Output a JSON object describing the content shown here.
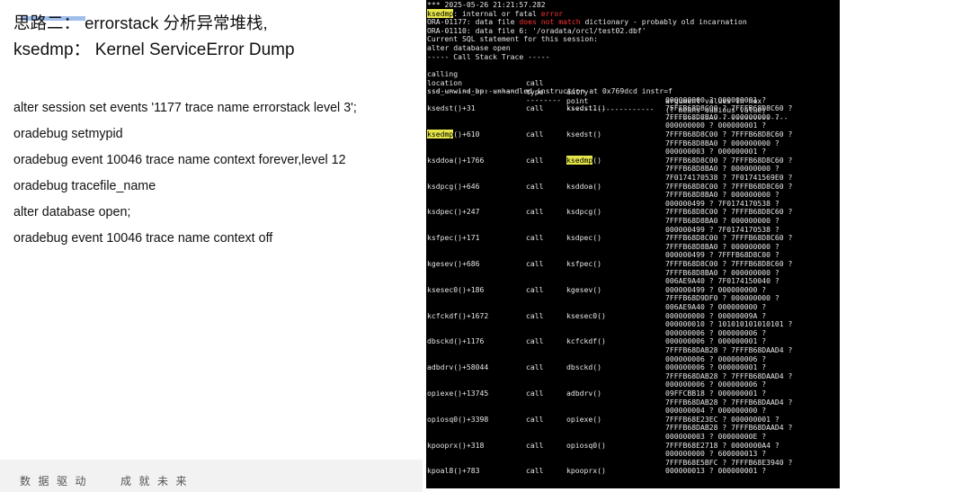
{
  "slide": {
    "title_line1": "思路二： errorstack 分析异常堆栈,",
    "title_line2": "ksedmp： Kernel ServiceError Dump",
    "commands": [
      "alter session set events '1177 trace name errorstack level 3';",
      "oradebug setmypid",
      "oradebug event 10046 trace name context forever,level 12",
      "oradebug tracefile_name",
      "alter database open;",
      "oradebug event 10046 trace name context off"
    ],
    "footer_left": "数据驱动",
    "footer_right": "成就未来"
  },
  "terminal": {
    "header_line": "*** 2025-05-26 21:21:57.282",
    "ksedmp_word": "ksedmp",
    "internal_text": ": internal or fatal ",
    "error_word": "error",
    "ora1_pre": "ORA-01177: data file ",
    "ora1_red": "does not match",
    "ora1_post": " dictionary - probably old incarnation",
    "ora2": "ORA-01110: data file 6: '/oradata/orcl/test02.dbf'",
    "sql_line": "Current SQL statement for this session:",
    "alter_line": "alter database open",
    "trace_title": "----- Call Stack Trace -----",
    "col_headers_1": [
      "calling",
      "call",
      "entry",
      "argument values in hex"
    ],
    "col_headers_2": [
      "location",
      "type",
      "point",
      "(? means dubious value)"
    ],
    "col_rules": [
      "--------------------",
      "--------",
      "--------------------",
      "----------------------------"
    ],
    "unwind": "ssd_unwind_bp: unhandled instruction at 0x769dcd instr=f",
    "frames": [
      {
        "loc": "ksedst()+31",
        "type": "call",
        "entry": "ksedst1()",
        "args": [
          "000000000 ? 000000001 ?",
          "7FFFB68D8C00 ? 7FFFB68D8C60 ?",
          "7FFFB68D8BA0 ? 000000000 ?"
        ]
      },
      {
        "loc": "ksedmp()+610",
        "type": "call",
        "entry": "ksedst()",
        "args": [
          "000000000 ? 000000001 ?",
          "7FFFB68D8C00 ? 7FFFB68D8C60 ?",
          "7FFFB68D8BA0 ? 000000000 ?"
        ]
      },
      {
        "loc": "ksddoa()+1766",
        "type": "call",
        "entry": "ksedmp()",
        "args": [
          "000000003 ? 000000001 ?",
          "7FFFB68D8C00 ? 7FFFB68D8C60 ?",
          "7FFFB68D8BA0 ? 000000000 ?"
        ]
      },
      {
        "loc": "ksdpcg()+646",
        "type": "call",
        "entry": "ksddoa()",
        "args": [
          "7F0174170538 ? 7F01741569E0 ?",
          "7FFFB68D8C00 ? 7FFFB68D8C60 ?",
          "7FFFB68D8BA0 ? 000000000 ?"
        ]
      },
      {
        "loc": "ksdpec()+247",
        "type": "call",
        "entry": "ksdpcg()",
        "args": [
          "000000499 ? 7F0174170538 ?",
          "7FFFB68D8C00 ? 7FFFB68D8C60 ?",
          "7FFFB68D8BA0 ? 000000000 ?"
        ]
      },
      {
        "loc": "ksfpec()+171",
        "type": "call",
        "entry": "ksdpec()",
        "args": [
          "000000499 ? 7F0174170538 ?",
          "7FFFB68D8C00 ? 7FFFB68D8C60 ?",
          "7FFFB68D8BA0 ? 000000000 ?"
        ]
      },
      {
        "loc": "kgesev()+686",
        "type": "call",
        "entry": "ksfpec()",
        "args": [
          "000000499 ? 7FFFB68D8C00 ?",
          "7FFFB68D8C00 ? 7FFFB68D8C60 ?",
          "7FFFB68D8BA0 ? 000000000 ?"
        ]
      },
      {
        "loc": "ksesec0()+186",
        "type": "call",
        "entry": "kgesev()",
        "args": [
          "006AE9A40 ? 7F0174150040 ?",
          "000000499 ? 000000000 ?",
          "7FFFB68D9DF0 ? 000000000 ?"
        ]
      },
      {
        "loc": "kcfckdf()+1672",
        "type": "call",
        "entry": "ksesec0()",
        "args": [
          "006AE9A40 ? 000000000 ?",
          "000000000 ? 00000009A ?",
          "000000010 ? 101010101010101 ?"
        ]
      },
      {
        "loc": "dbsckd()+1176",
        "type": "call",
        "entry": "kcfckdf()",
        "args": [
          "000000006 ? 000000006 ?",
          "000000006 ? 000000001 ?",
          "7FFFB68DAB28 ? 7FFFB68DAAD4 ?"
        ]
      },
      {
        "loc": "adbdrv()+58044",
        "type": "call",
        "entry": "dbsckd()",
        "args": [
          "000000006 ? 000000006 ?",
          "000000006 ? 000000001 ?",
          "7FFFB68DAB28 ? 7FFFB68DAAD4 ?"
        ]
      },
      {
        "loc": "opiexe()+13745",
        "type": "call",
        "entry": "adbdrv()",
        "args": [
          "000000006 ? 000000006 ?",
          "09FFCBB18 ? 000000001 ?",
          "7FFFB68DAB28 ? 7FFFB68DAAD4 ?"
        ]
      },
      {
        "loc": "opiosq0()+3398",
        "type": "call",
        "entry": "opiexe()",
        "args": [
          "000000004 ? 000000000 ?",
          "7FFFB68E23EC ? 000000001 ?",
          "7FFFB68DAB28 ? 7FFFB68DAAD4 ?"
        ]
      },
      {
        "loc": "kpooprx()+318",
        "type": "call",
        "entry": "opiosq0()",
        "args": [
          "000000003 ? 00000000E ?",
          "7FFFB68E2718 ? 0000000A4 ?",
          "000000000 ? 600000013 ?"
        ]
      },
      {
        "loc": "kpoal8()+783",
        "type": "call",
        "entry": "kpooprx()",
        "args": [
          "7FFFB68E5BFC ? 7FFFB68E3940 ?",
          "000000013 ? 000000001 ?"
        ]
      }
    ]
  }
}
